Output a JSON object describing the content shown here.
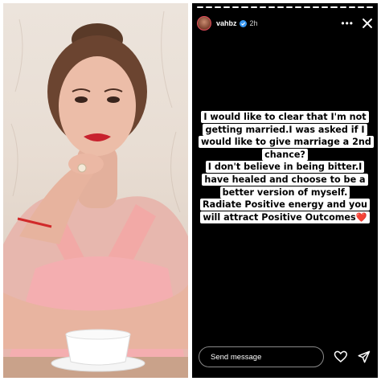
{
  "story": {
    "username": "vahbz",
    "time_ago": "2h",
    "progress_segments": 20,
    "progress_done": 20,
    "caption_lines": [
      "I would like to clear that I'm not",
      "getting married.I was asked if I",
      "would like to give marriage a 2nd",
      "chance?",
      "I don't believe in being bitter.I",
      "have healed and choose to be a",
      "better version of myself.",
      "Radiate Positive energy and you",
      "will attract Positive Outcomes"
    ],
    "caption_emoji": "❤️",
    "reply_placeholder": "Send message"
  },
  "icons": {
    "more": "more-options-icon",
    "close": "close-icon",
    "like": "heart-icon",
    "share": "paper-plane-icon",
    "verified": "verified-badge-icon"
  },
  "colors": {
    "story_background": "#000000",
    "caption_background": "#ffffff",
    "verified_blue": "#3897f0",
    "heart_red": "#e0262e"
  }
}
